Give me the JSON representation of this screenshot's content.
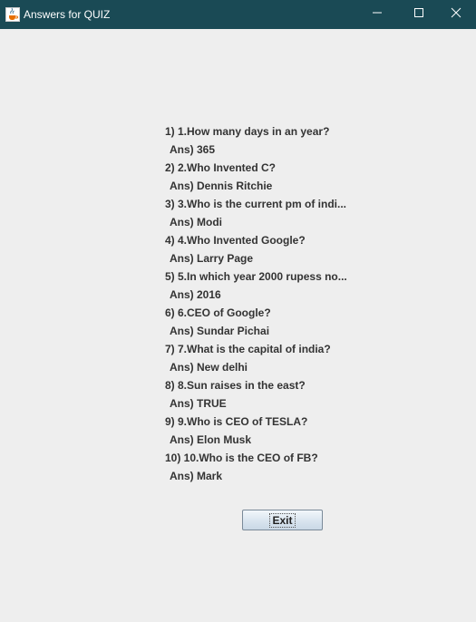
{
  "window": {
    "title": "Answers for QUIZ"
  },
  "qa": [
    {
      "question": "1) 1.How many days in an year?",
      "answer": "Ans) 365"
    },
    {
      "question": "2) 2.Who Invented C?",
      "answer": "Ans) Dennis Ritchie"
    },
    {
      "question": "3) 3.Who is the current pm of indi...",
      "answer": "Ans) Modi"
    },
    {
      "question": "4) 4.Who Invented Google?",
      "answer": "Ans) Larry Page"
    },
    {
      "question": "5) 5.In which year 2000 rupess no...",
      "answer": "Ans) 2016"
    },
    {
      "question": "6) 6.CEO of Google?",
      "answer": "Ans) Sundar Pichai"
    },
    {
      "question": "7) 7.What is the capital of india?",
      "answer": "Ans) New delhi"
    },
    {
      "question": "8) 8.Sun raises in the east?",
      "answer": "Ans) TRUE"
    },
    {
      "question": "9) 9.Who is CEO of TESLA?",
      "answer": "Ans) Elon Musk"
    },
    {
      "question": "10) 10.Who is the CEO of FB?",
      "answer": "Ans) Mark"
    }
  ],
  "buttons": {
    "exit_label": "Exit"
  },
  "icons": {
    "app": "java-cup-icon",
    "minimize": "minimize-icon",
    "maximize": "maximize-icon",
    "close": "close-icon"
  },
  "colors": {
    "titlebar": "#1a4a55",
    "background": "#eeeeee",
    "text": "#333333"
  }
}
